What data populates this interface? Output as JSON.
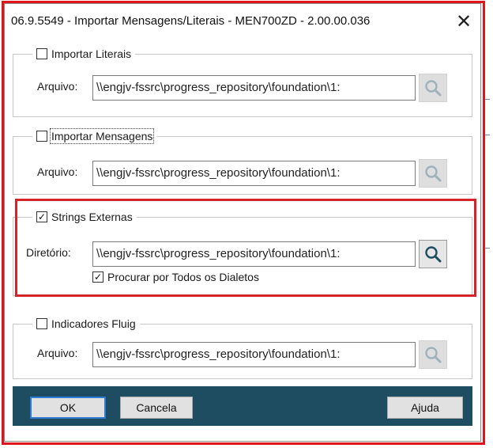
{
  "window": {
    "title": "06.9.5549 - Importar Mensagens/Literais - MEN700ZD - 2.00.00.036",
    "close_glyph": "✕"
  },
  "groups": [
    {
      "legend": "Importar Literais",
      "checked": false,
      "field_label": "Arquivo:",
      "path": "\\\\engjv-fssrc\\progress_repository\\foundation\\1:",
      "search_enabled": false
    },
    {
      "legend": "Importar Mensagens",
      "checked": false,
      "field_label": "Arquivo:",
      "path": "\\\\engjv-fssrc\\progress_repository\\foundation\\1:",
      "search_enabled": false
    },
    {
      "legend": "Strings Externas",
      "checked": true,
      "field_label": "Diretório:",
      "path": "\\\\engjv-fssrc\\progress_repository\\foundation\\1:",
      "search_enabled": true,
      "sub_option": {
        "label": "Procurar por Todos os Dialetos",
        "checked": true
      }
    },
    {
      "legend": "Indicadores Fluig",
      "checked": false,
      "field_label": "Arquivo:",
      "path": "\\\\engjv-fssrc\\progress_repository\\foundation\\1:",
      "search_enabled": false
    }
  ],
  "buttons": {
    "ok": "OK",
    "cancel": "Cancela",
    "help": "Ajuda"
  },
  "icons": {
    "search": "search-icon",
    "checkmark": "✓"
  },
  "colors": {
    "footer": "#1e4d61",
    "highlight": "#d4242a",
    "frame": "#e0141c",
    "search_enabled": "#1e4d61",
    "search_disabled": "#9fb2bb"
  }
}
